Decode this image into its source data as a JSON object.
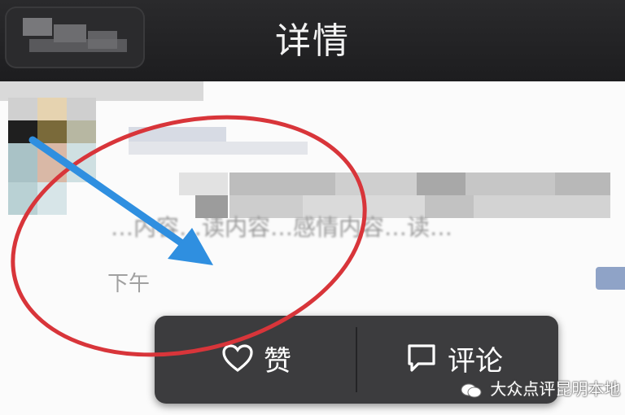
{
  "header": {
    "title": "详情"
  },
  "post": {
    "blurred_text": "…内容…读内容…感情内容…读…",
    "time": "下午"
  },
  "popup": {
    "like_label": "赞",
    "comment_label": "评论"
  },
  "watermark": {
    "text": "大众点评昆明本地"
  },
  "colors": {
    "header_bg": "#1d1d1f",
    "popup_bg": "#3c3c3e",
    "circle_annotation": "#d8353a",
    "arrow_annotation": "#2f8fe0"
  },
  "icons": {
    "like": "heart-icon",
    "comment": "speech-bubble-icon",
    "watermark": "wechat-icon"
  }
}
